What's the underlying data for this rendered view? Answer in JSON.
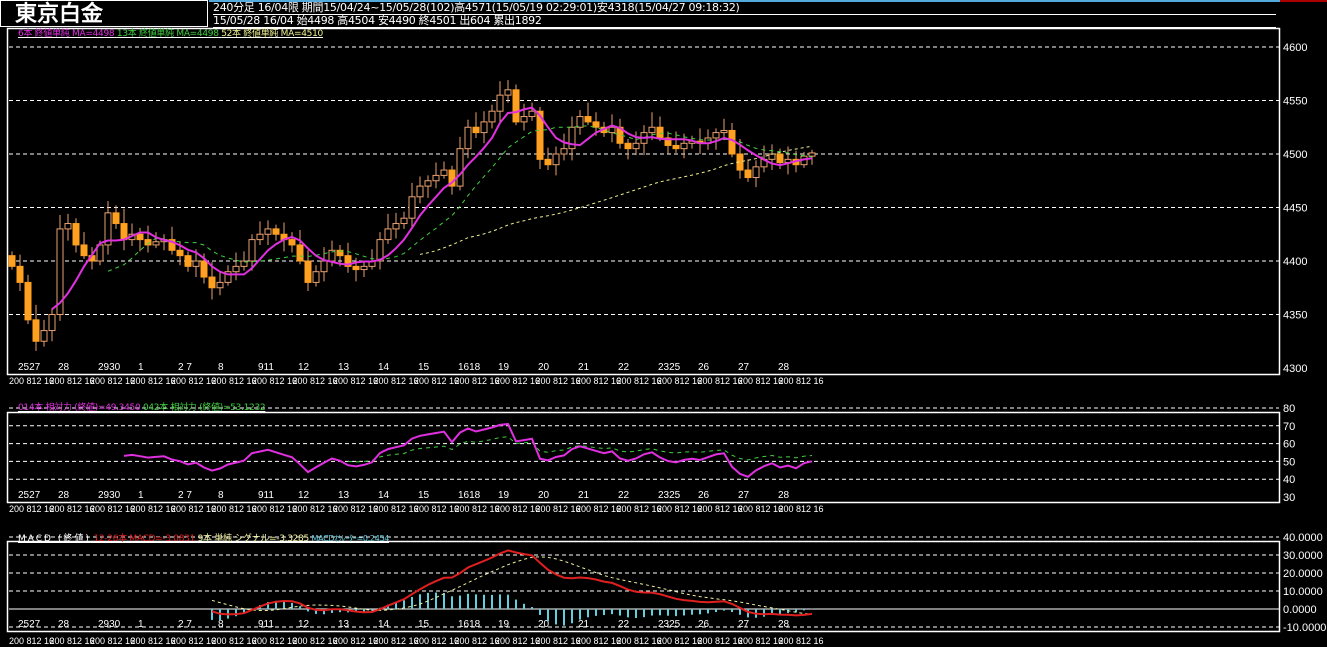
{
  "header": {
    "title": "東京白金",
    "line1": "240分足  16/04限  期間15/04/24~15/05/28(102)高4571(15/05/19 02:29:01)安4318(15/04/27 09:18:32)",
    "line2": "15/05/28 16/04 始4498 高4504 安4490 終4501 出604 累出1892"
  },
  "legends": {
    "ma6": "6本 終値単純 MA=4498",
    "ma13": "13本 終値単純 MA=4498",
    "ma52": "52本 終値単純 MA=4510",
    "rsi14": "014本 相対力 (終値)=49.3450",
    "rsi42": "042本 相対力 (終値)=53.1232",
    "macd_title": "MACD (終値)",
    "macd": "12-26本 MACD=-3.0831",
    "signal": "9本 単純 シグナル=-3.3285",
    "osc": "MACDｵｼﾚｰﾀｰ=0.2454"
  },
  "colors": {
    "ma6": "#e030e0",
    "ma13": "#40d040",
    "ma52": "#f0f090",
    "candle_down": "#ffa020",
    "candle_up": "#e8a070",
    "macd": "#e02020",
    "signal": "#f0f0a0",
    "osc": "#60d0e0",
    "grid": "#ffffff"
  },
  "chart_data": [
    {
      "type": "candlestick",
      "title": "東京白金 240分足",
      "ylim": [
        4300,
        4600
      ],
      "yticks": [
        4600,
        4550,
        4500,
        4450,
        4400,
        4350,
        4300
      ],
      "date_labels": [
        "2527",
        "28",
        "2930",
        "1",
        "2 7",
        "8",
        "911",
        "12",
        "13",
        "14",
        "15",
        "1618",
        "19",
        "20",
        "21",
        "22",
        "2325",
        "26",
        "27",
        "28"
      ],
      "time_row_label": "200 812 16",
      "close": [
        4395,
        4380,
        4345,
        4325,
        4335,
        4350,
        4430,
        4435,
        4415,
        4405,
        4400,
        4415,
        4445,
        4435,
        4420,
        4425,
        4420,
        4415,
        4418,
        4420,
        4410,
        4405,
        4395,
        4400,
        4385,
        4375,
        4380,
        4390,
        4395,
        4400,
        4420,
        4425,
        4430,
        4425,
        4420,
        4415,
        4400,
        4380,
        4390,
        4400,
        4410,
        4405,
        4395,
        4392,
        4395,
        4400,
        4420,
        4430,
        4435,
        4440,
        4460,
        4470,
        4475,
        4480,
        4485,
        4470,
        4505,
        4525,
        4520,
        4530,
        4540,
        4555,
        4560,
        4530,
        4535,
        4540,
        4495,
        4490,
        4500,
        4505,
        4525,
        4535,
        4530,
        4525,
        4520,
        4525,
        4510,
        4505,
        4510,
        4520,
        4525,
        4515,
        4508,
        4505,
        4510,
        4512,
        4510,
        4515,
        4520,
        4522,
        4500,
        4485,
        4478,
        4488,
        4495,
        4500,
        4492,
        4495,
        4490,
        4498,
        4501
      ],
      "first_open": 4405,
      "last_bar": {
        "open": 4498,
        "high": 4504,
        "low": 4490,
        "close": 4501
      },
      "moving_averages": [
        6,
        13,
        52
      ]
    },
    {
      "type": "line",
      "title": "相対力 (RSI)",
      "periods": [
        14,
        42
      ],
      "ylim": [
        30,
        80
      ],
      "yticks": [
        80,
        70,
        60,
        50,
        40,
        30
      ],
      "last_values": [
        49.345,
        53.1232
      ]
    },
    {
      "type": "line",
      "title": "MACD (終値)",
      "fast": 12,
      "slow": 26,
      "signal": 9,
      "ylim": [
        -10,
        40
      ],
      "yticks": [
        "40.0000",
        "30.0000",
        "20.0000",
        "10.0000",
        "0.0000",
        "-10.0000"
      ],
      "last_values": {
        "macd": -3.0831,
        "signal": -3.3285,
        "oscillator": 0.2454
      }
    }
  ]
}
